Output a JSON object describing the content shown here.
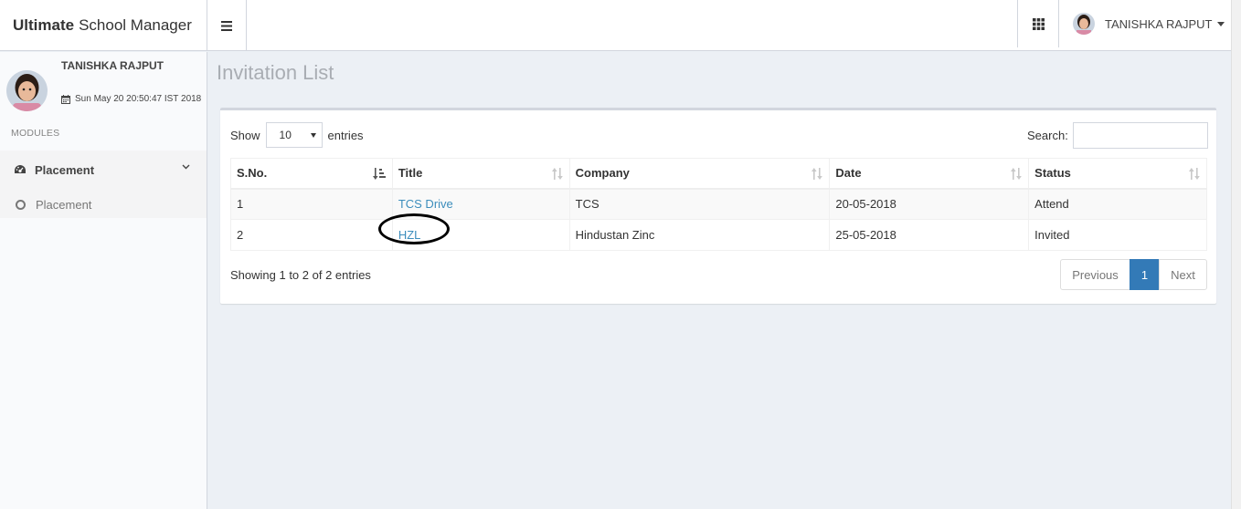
{
  "header": {
    "brand_bold": "Ultimate",
    "brand_rest": "School Manager",
    "user_name": "TANISHKA RAJPUT"
  },
  "sidebar": {
    "user_name": "TANISHKA RAJPUT",
    "datetime": "Sun May 20 20:50:47 IST 2018",
    "modules_label": "MODULES",
    "menu_label": "Placement",
    "submenu_label": "Placement"
  },
  "page": {
    "title": "Invitation List"
  },
  "table_controls": {
    "show_label": "Show",
    "entries_value": "10",
    "entries_label": "entries",
    "search_label": "Search:",
    "search_value": ""
  },
  "table": {
    "columns": [
      "S.No.",
      "Title",
      "Company",
      "Date",
      "Status"
    ],
    "rows": [
      {
        "sno": "1",
        "title": "TCS Drive",
        "company": "TCS",
        "date": "20-05-2018",
        "status": "Attend"
      },
      {
        "sno": "2",
        "title": "HZL",
        "company": "Hindustan Zinc",
        "date": "25-05-2018",
        "status": "Invited"
      }
    ]
  },
  "footer": {
    "info": "Showing 1 to 2 of 2 entries",
    "previous": "Previous",
    "current_page": "1",
    "next": "Next"
  },
  "colors": {
    "link": "#3c8dbc",
    "active_page": "#337ab7",
    "content_bg": "#ecf0f5"
  }
}
